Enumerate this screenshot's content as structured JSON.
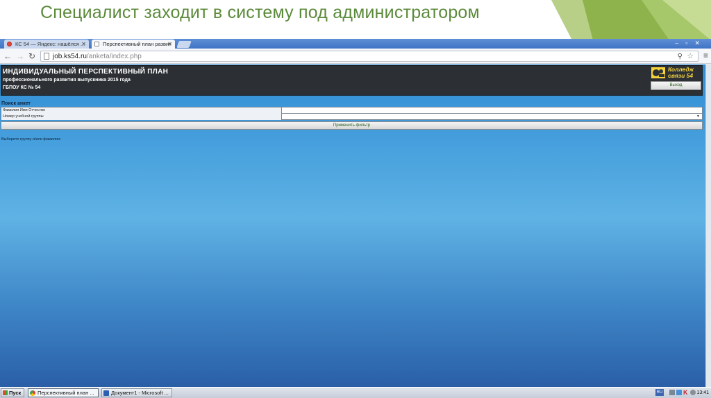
{
  "slide": {
    "title": "Специалист заходит в систему под администратором",
    "accent_color": "#5b8a3a"
  },
  "browser": {
    "tabs": [
      {
        "label": "КС 54 — Яндекс: нашёлся ...",
        "icon": "yandex-icon",
        "active": false
      },
      {
        "label": "Перспективный план развит",
        "icon": "page-icon",
        "active": true
      }
    ],
    "url_host": "job.ks54.ru",
    "url_path": "/anketa/index.php"
  },
  "site": {
    "title": "ИНДИВИДУАЛЬНЫЙ ПЕРСПЕКТИВНЫЙ ПЛАН",
    "subtitle": "профессионального развития выпускника 2015 года",
    "org": "ГБПОУ КС № 54",
    "logo_line1": "Колледж",
    "logo_line2": "связи 54",
    "logout_label": "Выход",
    "header_color": "#2c3035"
  },
  "search": {
    "heading": "Поиск анкет",
    "fio_label": "Фамилия Имя Отчество",
    "fio_value": "",
    "group_label": "Номер учебной группы",
    "group_value": "",
    "apply_label": "Применить фильтр",
    "hint": "Выберите группу и/или фамилию"
  },
  "taskbar": {
    "start_label": "Пуск",
    "items": [
      {
        "label": "Перспективный план ...",
        "icon": "chrome-icon",
        "active": true
      },
      {
        "label": "Документ1 - Microsoft ...",
        "icon": "word-icon",
        "active": false
      }
    ],
    "lang": "RU",
    "clock": "13:41"
  }
}
